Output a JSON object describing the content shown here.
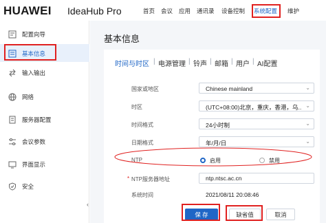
{
  "header": {
    "brand": "HUAWEI",
    "product": "IdeaHub Pro",
    "nav": [
      "首页",
      "会议",
      "应用",
      "通讯录",
      "设备控制",
      "系统配置",
      "维护"
    ],
    "active_nav": "系统配置"
  },
  "sidebar": {
    "items": [
      {
        "label": "配置向导",
        "icon": "wizard-icon"
      },
      {
        "label": "基本信息",
        "icon": "info-icon",
        "active": true
      },
      {
        "label": "输入输出",
        "icon": "io-icon"
      },
      {
        "label": "网络",
        "icon": "globe-icon"
      },
      {
        "label": "服务器配置",
        "icon": "server-icon"
      },
      {
        "label": "会议参数",
        "icon": "sliders-icon"
      },
      {
        "label": "界面显示",
        "icon": "display-icon"
      },
      {
        "label": "安全",
        "icon": "shield-icon"
      }
    ],
    "collapse_glyph": "‹"
  },
  "page": {
    "title": "基本信息",
    "tabs": [
      "时间与时区",
      "电源管理",
      "铃声",
      "邮箱",
      "用户",
      "AI配置"
    ],
    "tab_separator": "|",
    "form": {
      "country_label": "国家或地区",
      "country_value": "Chinese mainland",
      "timezone_label": "时区",
      "timezone_value": "(UTC+08:00)北京，重庆，香港，乌...",
      "time_format_label": "时间格式",
      "time_format_value": "24小时制",
      "date_format_label": "日期格式",
      "date_format_value": "年/月/日",
      "ntp_label": "NTP",
      "ntp_on_label": "启用",
      "ntp_off_label": "禁用",
      "ntp_enabled": true,
      "ntp_server_label": "NTP服务器地址",
      "ntp_server_required_mark": "*",
      "ntp_server_value": "ntp.ntsc.ac.cn",
      "system_time_label": "系统时间",
      "system_time_value": "2021/08/11 20:08:46"
    },
    "buttons": {
      "save": "保 存",
      "default": "缺省值",
      "cancel": "取消"
    }
  },
  "colors": {
    "accent": "#1f66c6",
    "highlight": "#e0201f",
    "page_bg": "#f4f6f9"
  }
}
